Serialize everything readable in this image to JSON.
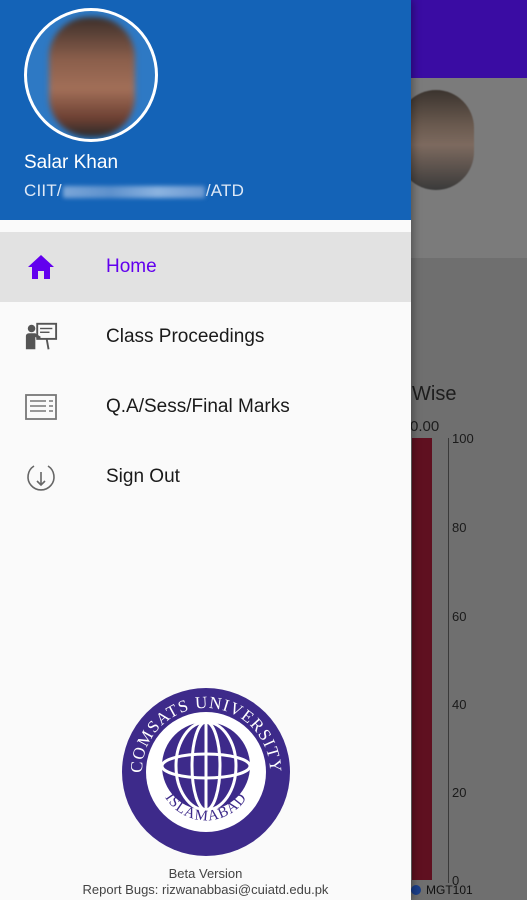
{
  "profile": {
    "name": "Salar Khan",
    "id_prefix": "CIIT/",
    "id_suffix": "/ATD"
  },
  "menu": [
    {
      "label": "Home",
      "icon": "home-icon",
      "active": true
    },
    {
      "label": "Class Proceedings",
      "icon": "teacher-board-icon",
      "active": false
    },
    {
      "label": "Q.A/Sess/Final Marks",
      "icon": "marks-sheet-icon",
      "active": false
    },
    {
      "label": "Sign Out",
      "icon": "sign-out-icon",
      "active": false
    }
  ],
  "logo": {
    "top_text": "COMSATS UNIVERSITY",
    "bottom_text": "ISLAMABAD"
  },
  "footer": {
    "beta": "Beta Version",
    "bugs": "Report Bugs: rizwanabbasi@cuiatd.edu.pk"
  },
  "background": {
    "chart_title_fragment": "Wise",
    "value_fragment": "0.00",
    "y_ticks": [
      "100",
      "80",
      "60",
      "40",
      "20",
      "0"
    ],
    "legend": "MGT101"
  },
  "colors": {
    "header_blue": "#1463b7",
    "accent_purple": "#6200ee",
    "topbar": "#3a0ca3"
  }
}
